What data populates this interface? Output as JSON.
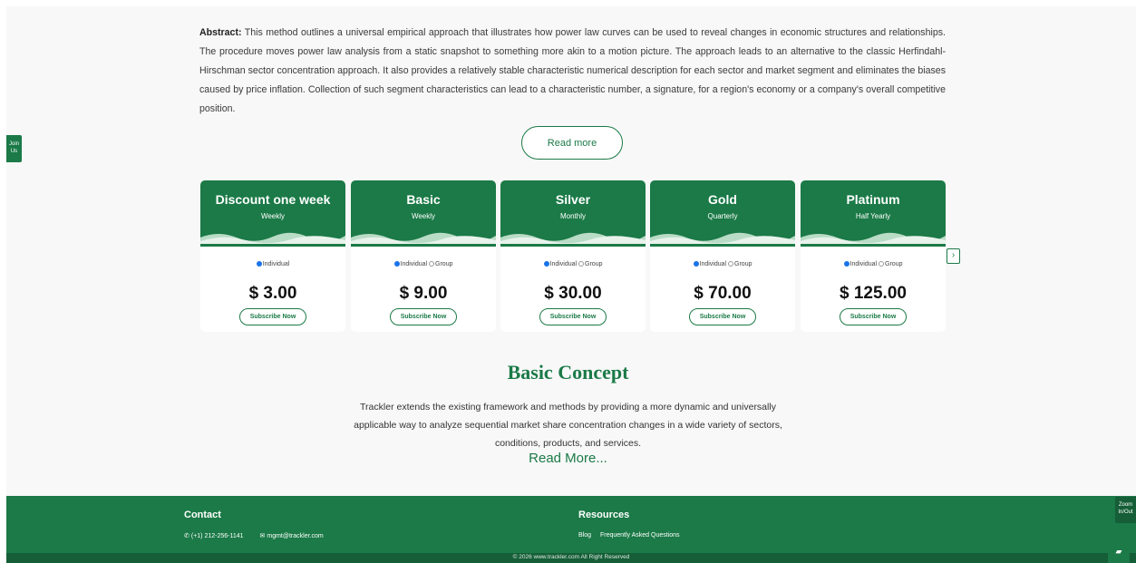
{
  "abstract": {
    "label": "Abstract:",
    "text": "This method outlines a universal empirical approach that illustrates how power law curves can be used to reveal changes in economic structures and relationships. The procedure moves power law analysis from a static snapshot to something more akin to a motion picture. The approach leads to an alternative to the classic Herfindahl-Hirschman sector concentration approach. It also provides a relatively stable characteristic numerical description for each sector and market segment and eliminates the biases caused by price inflation. Collection of such segment characteristics can lead to a characteristic number, a signature, for a region's economy or a company's overall competitive position."
  },
  "read_more_label": "Read more",
  "side_tab": {
    "line1": "Join",
    "line2": "Us"
  },
  "plans": [
    {
      "title": "Discount one week",
      "period": "Weekly",
      "opt1": "Individual",
      "opt2": "",
      "price": "$ 3.00",
      "cta": "Subscribe Now"
    },
    {
      "title": "Basic",
      "period": "Weekly",
      "opt1": "Individual",
      "opt2": "Group",
      "price": "$ 9.00",
      "cta": "Subscribe Now"
    },
    {
      "title": "Silver",
      "period": "Monthly",
      "opt1": "Individual",
      "opt2": "Group",
      "price": "$ 30.00",
      "cta": "Subscribe Now"
    },
    {
      "title": "Gold",
      "period": "Quarterly",
      "opt1": "Individual",
      "opt2": "Group",
      "price": "$ 70.00",
      "cta": "Subscribe Now"
    },
    {
      "title": "Platinum",
      "period": "Half Yearly",
      "opt1": "Individual",
      "opt2": "Group",
      "price": "$ 125.00",
      "cta": "Subscribe Now"
    }
  ],
  "next_label": "›",
  "concept": {
    "title": "Basic Concept",
    "text": "Trackler extends the existing framework and methods by providing a more dynamic and universally applicable way to analyze sequential market share concentration changes in a wide variety of sectors, conditions, products, and services.",
    "read_more": "Read More..."
  },
  "footer": {
    "contact_heading": "Contact",
    "phone": "(+1) 212-256-1141",
    "email": "mgmt@trackler.com",
    "resources_heading": "Resources",
    "blog": "Blog",
    "faq": "Frequently Asked Questions",
    "copyright": "© 2026  www.trackler.com  All Right Reserved"
  },
  "zoom": {
    "line1": "Zoom",
    "line2": "In/Out"
  },
  "colors": {
    "brand_green": "#1b7a47",
    "dark_green": "#155e37",
    "radio_blue": "#1a73e8"
  },
  "icons": {
    "phone": "phone-icon",
    "email": "envelope-icon",
    "chat": "chat-icon",
    "next": "chevron-right-icon"
  }
}
